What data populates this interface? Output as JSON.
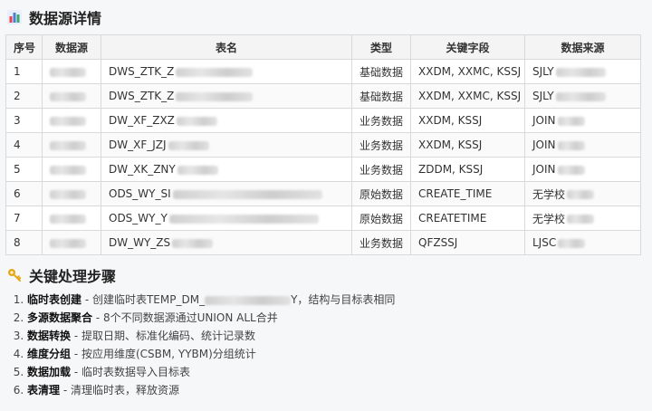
{
  "page": {
    "title": "数据源详情",
    "steps_title": "关键处理步骤"
  },
  "table": {
    "headers": [
      "序号",
      "数据源",
      "表名",
      "类型",
      "关键字段",
      "数据来源"
    ],
    "rows": [
      {
        "no": "1",
        "name": "DWS_ZTK_Z",
        "type": "基础数据",
        "fields": "XXDM, XXMC, KSSJ",
        "source": "SJLY"
      },
      {
        "no": "2",
        "name": "DWS_ZTK_Z",
        "type": "基础数据",
        "fields": "XXDM, XXMC, KSSJ",
        "source": "SJLY"
      },
      {
        "no": "3",
        "name": "DW_XF_ZXZ",
        "type": "业务数据",
        "fields": "XXDM, KSSJ",
        "source": "JOIN"
      },
      {
        "no": "4",
        "name": "DW_XF_JZJ",
        "type": "业务数据",
        "fields": "XXDM, KSSJ",
        "source": "JOIN"
      },
      {
        "no": "5",
        "name": "DW_XK_ZNY",
        "type": "业务数据",
        "fields": "ZDDM, KSSJ",
        "source": "JOIN"
      },
      {
        "no": "6",
        "name": "ODS_WY_SI",
        "type": "原始数据",
        "fields": "CREATE_TIME",
        "source": "无学校"
      },
      {
        "no": "7",
        "name": "ODS_WY_Y",
        "type": "原始数据",
        "fields": "CREATETIME",
        "source": "无学校"
      },
      {
        "no": "8",
        "name": "DW_WY_ZS",
        "type": "业务数据",
        "fields": "QFZSSJ",
        "source": "LJSC"
      }
    ]
  },
  "steps": [
    {
      "bold": "临时表创建",
      "text": " - 创建临时表TEMP_DM_",
      "tail": "Y，结构与目标表相同"
    },
    {
      "bold": "多源数据聚合",
      "text": " - 8个不同数据源通过UNION ALL合并",
      "tail": ""
    },
    {
      "bold": "数据转换",
      "text": " - 提取日期、标准化编码、统计记录数",
      "tail": ""
    },
    {
      "bold": "维度分组",
      "text": " - 按应用维度(CSBM, YYBM)分组统计",
      "tail": ""
    },
    {
      "bold": "数据加载",
      "text": " - 临时表数据导入目标表",
      "tail": ""
    },
    {
      "bold": "表清理",
      "text": " - 清理临时表，释放资源",
      "tail": ""
    }
  ],
  "icons": {
    "title": "bar-chart-icon",
    "steps": "key-icon"
  },
  "colors": {
    "bar_red": "#e84545",
    "bar_blue": "#4a7fd8",
    "bar_green": "#3ba86a",
    "key": "#e6a817"
  }
}
